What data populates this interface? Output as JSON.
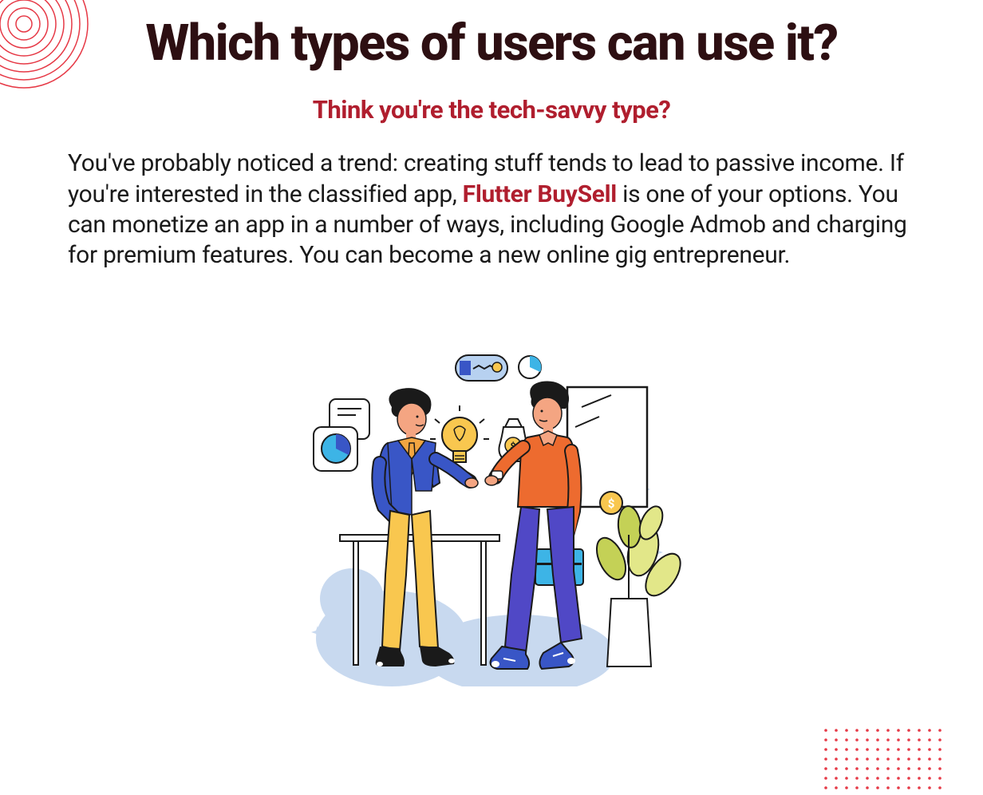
{
  "title": "Which types of users can use it?",
  "subtitle": "Think you're the tech-savvy type?",
  "body_text_before": "You've probably noticed a trend: creating stuff tends to lead to passive income. If you're interested in the classified app, ",
  "body_text_highlight": "Flutter BuySell",
  "body_text_after": " is one of your options. You can monetize an app in a number of ways, including Google Admob and charging for premium features. You can become a new online gig entrepreneur.",
  "colors": {
    "accent": "#b01e2e",
    "title": "#2d0f12",
    "decoration": "#e63946"
  }
}
